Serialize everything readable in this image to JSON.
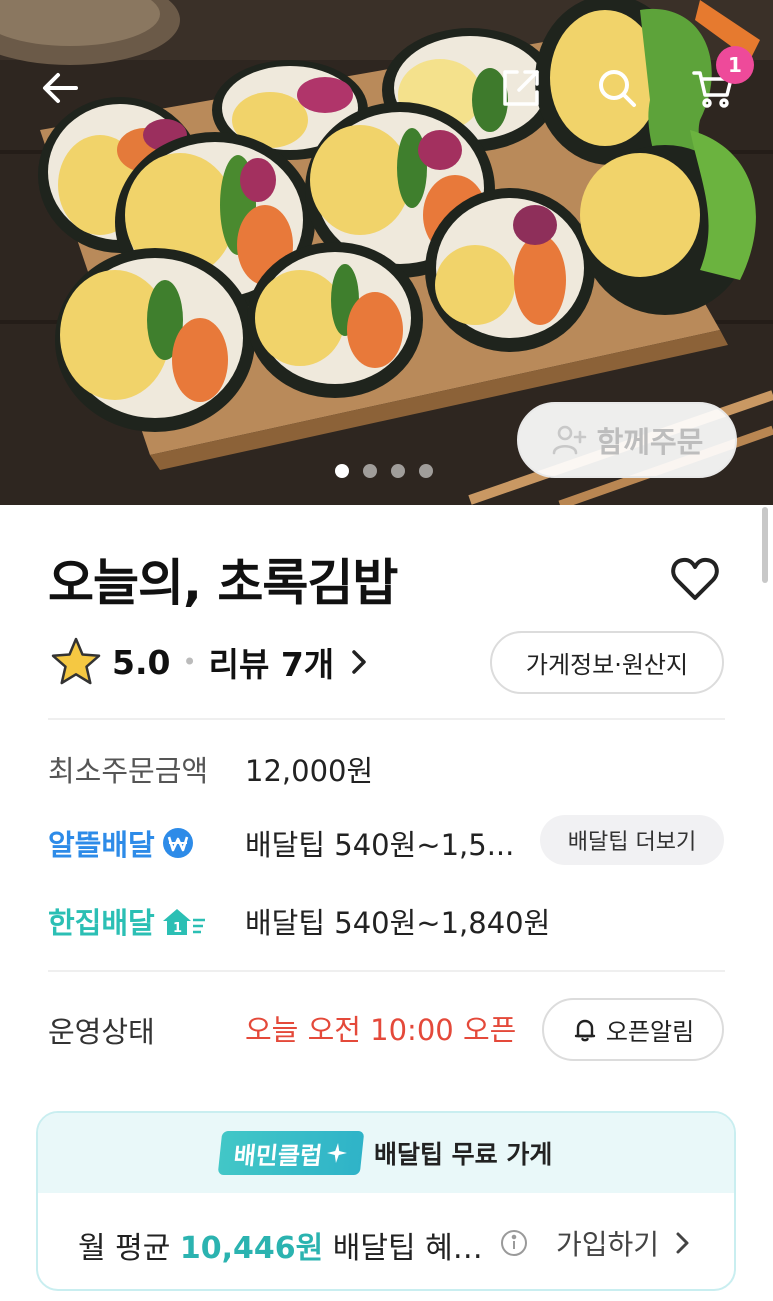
{
  "hero": {
    "cart_count": "1",
    "group_order_label": "함께주문",
    "slides": 4,
    "active_slide": 1
  },
  "store": {
    "name": "오늘의, 초록김밥",
    "rating": "5.0",
    "review_label": "리뷰 7개",
    "info_button": "가게정보·원산지"
  },
  "order": {
    "min_order_label": "최소주문금액",
    "min_order_value": "12,000원",
    "saver_delivery_label": "알뜰배달",
    "saver_delivery_value": "배달팁 540원~1,5...",
    "more_tip_button": "배달팁 더보기",
    "single_delivery_label": "한집배달",
    "single_delivery_value": "배달팁 540원~1,840원",
    "status_label": "운영상태",
    "status_value": "오늘 오전 10:00 오픈",
    "open_alert_button": "오픈알림"
  },
  "club": {
    "logo_text": "배민클럽",
    "title": "배달팁 무료 가게",
    "text_prefix": "월 평균 ",
    "amount": "10,446원",
    "text_suffix": " 배달팁 혜…",
    "join_label": "가입하기"
  },
  "colors": {
    "cart_badge": "#ee4a9a",
    "saver_blue": "#2d8be8",
    "single_teal": "#2bbfb4",
    "status_red": "#e4493a",
    "club_amount": "#2bb3b0"
  },
  "icons": [
    "back-arrow-icon",
    "share-icon",
    "search-icon",
    "cart-icon",
    "person-add-icon",
    "heart-icon",
    "star-icon",
    "chevron-right-icon",
    "won-coin-icon",
    "house-speed-icon",
    "bell-icon",
    "info-icon"
  ]
}
